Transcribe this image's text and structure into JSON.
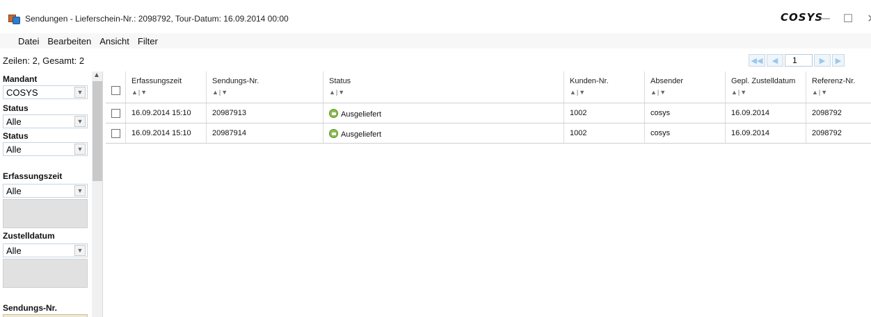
{
  "window": {
    "title": "Sendungen - Lieferschein-Nr.: 2098792, Tour-Datum: 16.09.2014 00:00",
    "brand": "COSYS"
  },
  "menu": [
    "Datei",
    "Bearbeiten",
    "Ansicht",
    "Filter"
  ],
  "rows_info": "Zeilen: 2, Gesamt: 2",
  "pager": {
    "page": "1"
  },
  "filters": {
    "mandant": {
      "label": "Mandant",
      "value": "COSYS"
    },
    "status1": {
      "label": "Status",
      "value": "Alle"
    },
    "status2": {
      "label": "Status",
      "value": "Alle"
    },
    "erfassungszeit": {
      "label": "Erfassungszeit",
      "value": "Alle"
    },
    "zustelldatum": {
      "label": "Zustelldatum",
      "value": "Alle"
    },
    "sendungsnr": {
      "label": "Sendungs-Nr."
    }
  },
  "grid": {
    "columns": [
      "Erfassungszeit",
      "Sendungs-Nr.",
      "Status",
      "Kunden-Nr.",
      "Absender",
      "Gepl. Zustelldatum",
      "Referenz-Nr."
    ],
    "rows": [
      [
        "16.09.2014 15:10",
        "20987913",
        "Ausgeliefert",
        "1002",
        "cosys",
        "16.09.2014",
        "2098792"
      ],
      [
        "16.09.2014 15:10",
        "20987914",
        "Ausgeliefert",
        "1002",
        "cosys",
        "16.09.2014",
        "2098792"
      ]
    ]
  },
  "colors": {
    "status_delivered": "#8bbf4f",
    "pager_accent": "#9cc7ea"
  }
}
